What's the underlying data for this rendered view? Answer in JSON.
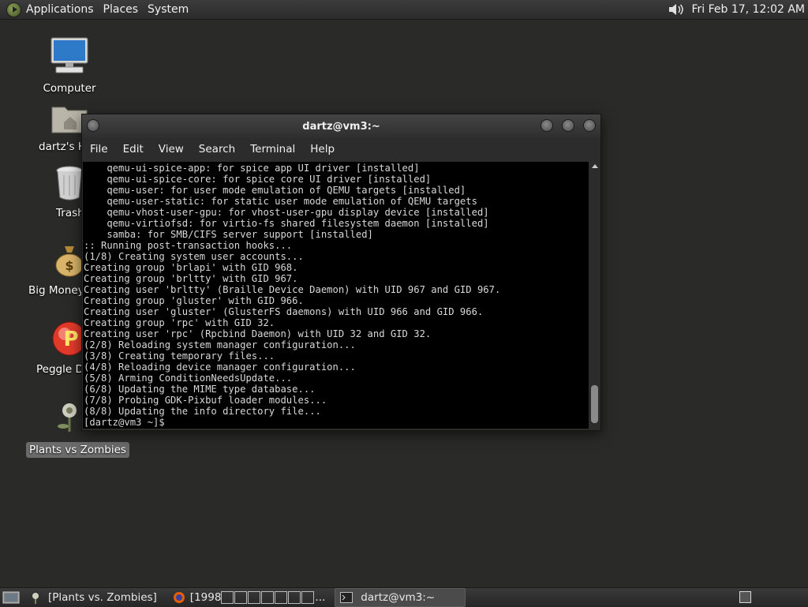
{
  "top_panel": {
    "menus": [
      "Applications",
      "Places",
      "System"
    ],
    "clock": "Fri Feb 17, 12:02 AM"
  },
  "desktop_icons": [
    {
      "label": "Computer",
      "icon": "computer-icon"
    },
    {
      "label": "dartz's H",
      "icon": "home-folder-icon"
    },
    {
      "label": "Trash",
      "icon": "trash-icon"
    },
    {
      "label": "Big Money",
      "icon": "money-bag-icon"
    },
    {
      "label": "Peggle D",
      "icon": "peggle-icon"
    },
    {
      "label": "Plants vs Zombies",
      "icon": "plants-vs-zombies-icon"
    }
  ],
  "terminal": {
    "title": "dartz@vm3:~",
    "menu": [
      "File",
      "Edit",
      "View",
      "Search",
      "Terminal",
      "Help"
    ],
    "lines": [
      "    qemu-ui-spice-app: for spice app UI driver [installed]",
      "    qemu-ui-spice-core: for spice core UI driver [installed]",
      "    qemu-user: for user mode emulation of QEMU targets [installed]",
      "    qemu-user-static: for static user mode emulation of QEMU targets",
      "    qemu-vhost-user-gpu: for vhost-user-gpu display device [installed]",
      "    qemu-virtiofsd: for virtio-fs shared filesystem daemon [installed]",
      "    samba: for SMB/CIFS server support [installed]",
      ":: Running post-transaction hooks...",
      "(1/8) Creating system user accounts...",
      "Creating group 'brlapi' with GID 968.",
      "Creating group 'brltty' with GID 967.",
      "Creating user 'brltty' (Braille Device Daemon) with UID 967 and GID 967.",
      "Creating group 'gluster' with GID 966.",
      "Creating user 'gluster' (GlusterFS daemons) with UID 966 and GID 966.",
      "Creating group 'rpc' with GID 32.",
      "Creating user 'rpc' (Rpcbind Daemon) with UID 32 and GID 32.",
      "(2/8) Reloading system manager configuration...",
      "(3/8) Creating temporary files...",
      "(4/8) Reloading device manager configuration...",
      "(5/8) Arming ConditionNeedsUpdate...",
      "(6/8) Updating the MIME type database...",
      "(7/8) Probing GDK-Pixbuf loader modules...",
      "(8/8) Updating the info directory file...",
      "[dartz@vm3 ~]$ "
    ]
  },
  "taskbar": {
    "tasks": [
      {
        "label": "[Plants vs. Zombies]",
        "icon": "plants-vs-zombies-icon"
      },
      {
        "label": "[1998",
        "icon": "firefox-icon"
      },
      {
        "label": "dartz@vm3:~",
        "icon": "terminal-icon",
        "active": true
      }
    ]
  }
}
